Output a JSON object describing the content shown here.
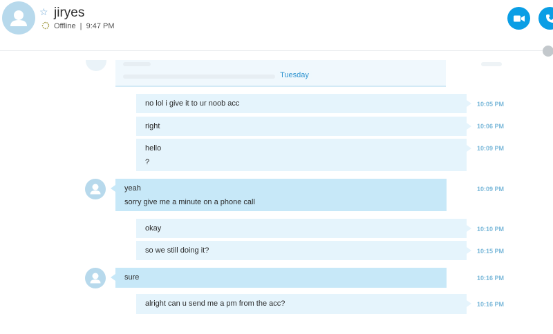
{
  "contact": {
    "name": "jiryes",
    "status": "Offline",
    "separator": "|",
    "last_seen": "9:47 PM"
  },
  "conversation": {
    "day_separator": "Tuesday",
    "messages": [
      {
        "direction": "out",
        "lines": [
          "no lol i give it to ur noob acc"
        ],
        "time": "10:05 PM"
      },
      {
        "direction": "out",
        "lines": [
          "right"
        ],
        "time": "10:06 PM"
      },
      {
        "direction": "out",
        "lines": [
          "hello",
          "?"
        ],
        "time": "10:09 PM"
      },
      {
        "direction": "in",
        "lines": [
          "yeah",
          "sorry give me a minute on a phone call"
        ],
        "time": "10:09 PM"
      },
      {
        "direction": "out",
        "lines": [
          "okay"
        ],
        "time": "10:10 PM"
      },
      {
        "direction": "out",
        "lines": [
          "so we still doing it?"
        ],
        "time": "10:15 PM"
      },
      {
        "direction": "in",
        "lines": [
          "sure"
        ],
        "time": "10:16 PM"
      },
      {
        "direction": "out",
        "lines": [
          "alright can u send me a pm from the acc?"
        ],
        "time": "10:16 PM"
      }
    ]
  },
  "icons": {
    "video_call": "video-camera-icon",
    "audio_call": "phone-icon",
    "favorite": "star-icon",
    "status": "offline-status-icon",
    "globe": "globe-icon"
  },
  "colors": {
    "accent": "#0a9ee5",
    "outgoing_bubble": "#e5f4fc",
    "incoming_bubble": "#c7e8f8",
    "timestamp": "#7ab8d9",
    "avatar": "#b7d9ec"
  }
}
